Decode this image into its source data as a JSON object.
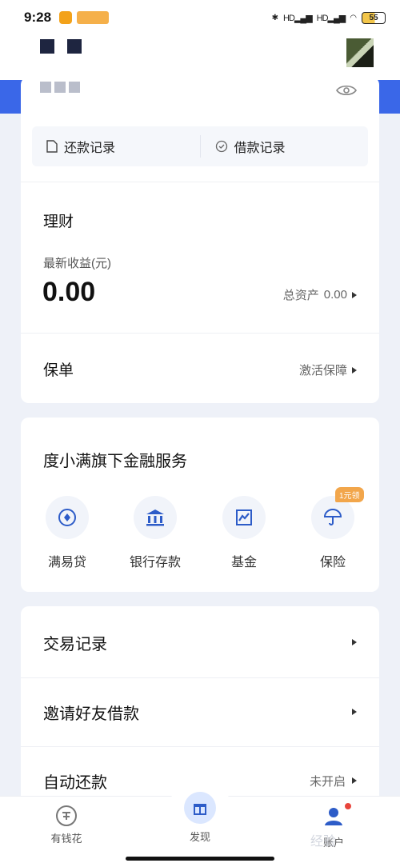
{
  "status_bar": {
    "time": "9:28",
    "signal1": "HD",
    "signal2": "HD",
    "battery": "55"
  },
  "card_top": {
    "repay_record": "还款记录",
    "borrow_record": "借款记录"
  },
  "finance": {
    "title": "理财",
    "latest_income_label": "最新收益(元)",
    "latest_income_value": "0.00",
    "total_assets_label": "总资产",
    "total_assets_value": "0.00"
  },
  "policy": {
    "title": "保单",
    "action": "激活保障"
  },
  "services": {
    "title": "度小满旗下金融服务",
    "items": [
      {
        "label": "满易贷",
        "icon": "loan-icon"
      },
      {
        "label": "银行存款",
        "icon": "bank-icon"
      },
      {
        "label": "基金",
        "icon": "fund-icon"
      },
      {
        "label": "保险",
        "icon": "umbrella-icon",
        "badge": "1元领"
      }
    ]
  },
  "menu": {
    "transactions": "交易记录",
    "invite": "邀请好友借款",
    "auto_repay": "自动还款",
    "auto_repay_status": "未开启"
  },
  "tabbar": {
    "items": [
      {
        "label": "有钱花",
        "icon": "wallet-icon"
      },
      {
        "label": "发现",
        "icon": "gift-icon"
      },
      {
        "label": "账户",
        "icon": "user-icon"
      }
    ]
  },
  "watermark": "经验",
  "colors": {
    "accent": "#3a67e8",
    "badge": "#f2a64b",
    "icon_blue": "#2d5cc8"
  }
}
